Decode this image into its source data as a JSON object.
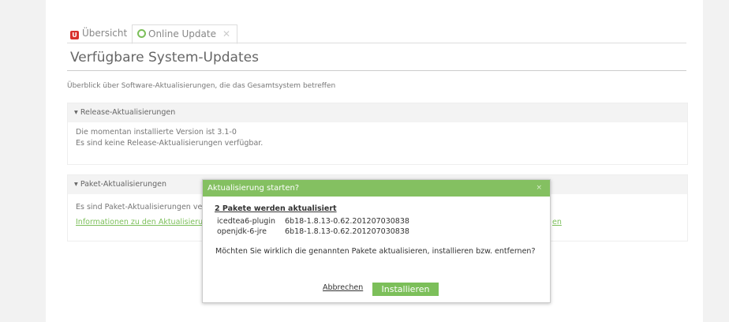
{
  "tabs": [
    {
      "label": "Übersicht",
      "icon": "univention-logo-icon"
    },
    {
      "label": "Online Update",
      "icon": "update-icon",
      "close": "✕"
    }
  ],
  "header": {
    "title": "Verfügbare System-Updates",
    "intro": "Überblick über Software-Aktualisierungen, die das Gesamtsystem betreffen"
  },
  "release_section": {
    "toggle": "▾",
    "title": "Release-Aktualisierungen",
    "line1": "Die momentan installierte Version ist 3.1-0",
    "line2": "Es sind keine Release-Aktualisierungen verfügbar."
  },
  "package_section": {
    "toggle": "▾",
    "title": "Paket-Aktualisierungen",
    "text": "Es sind Paket-Aktualisierungen ve",
    "link": "Informationen zu den Aktualisierun",
    "link_tail": "en"
  },
  "dialog": {
    "title": "Aktualisierung starten?",
    "close": "×",
    "subheading": "2 Pakete werden aktualisiert",
    "packages": [
      {
        "name": "icedtea6-plugin",
        "version": "6b18-1.8.13-0.62.201207030838"
      },
      {
        "name": "openjdk-6-jre",
        "version": "6b18-1.8.13-0.62.201207030838"
      }
    ],
    "question": "Möchten Sie wirklich die genannten Pakete aktualisieren, installieren bzw. entfernen?",
    "cancel_label": "Abbrechen",
    "install_label": "Installieren"
  },
  "colors": {
    "accent": "#7cbf5a",
    "brand_red": "#d9302c"
  }
}
